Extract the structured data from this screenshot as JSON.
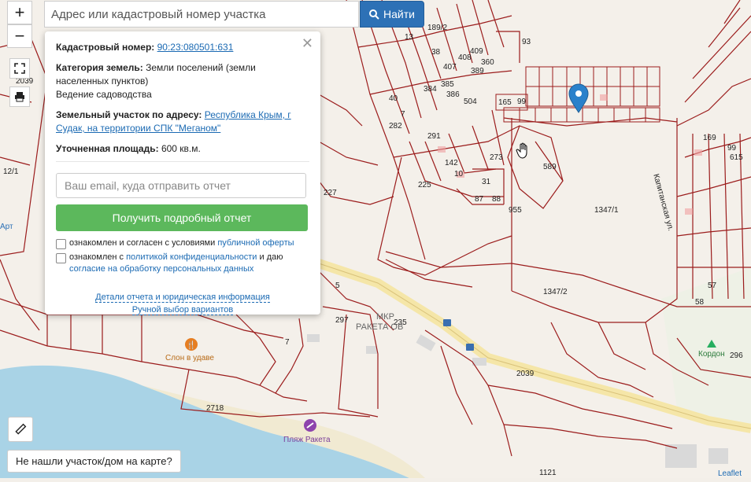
{
  "search": {
    "placeholder": "Адрес или кадастровый номер участка",
    "button_label": "Найти"
  },
  "controls": {
    "zoom_in": "+",
    "zoom_out": "−"
  },
  "popup": {
    "cadastral_label": "Кадастровый номер:",
    "cadastral_value": "90:23:080501:631",
    "category_label": "Категория земель:",
    "category_value": "Земли поселений (земли населенных пунктов)",
    "category_use": "Ведение садоводства",
    "address_label": "Земельный участок по адресу:",
    "address_value": "Республика Крым, г Судак, на территории СПК \"Меганом\"",
    "area_label": "Уточненная площадь:",
    "area_value": "600 кв.м.",
    "email_placeholder": "Ваш email, куда отправить отчет",
    "report_button": "Получить подробный отчет",
    "agree1_text": "ознакомлен и согласен с условиями",
    "agree1_link": "публичной оферты",
    "agree2_text_a": "ознакомлен с",
    "agree2_link_a": "политикой конфиденциальности",
    "agree2_text_b": "и даю",
    "agree2_link_b": "согласие на обработку персональных данных",
    "details_link": "Детали отчета и юридическая информация",
    "manual_link": "Ручной выбор вариантов"
  },
  "bottom_button": "Не нашли участок/дом на карте?",
  "attribution": "Leaflet",
  "map_labels": {
    "l_189_2": "189/2",
    "l_93": "93",
    "l_13": "13",
    "l_38": "38",
    "l_407": "407",
    "l_408": "408",
    "l_409": "409",
    "l_360": "360",
    "l_389": "389",
    "l_385": "385",
    "l_384": "384",
    "l_386": "386",
    "l_504": "504",
    "l_165": "165",
    "l_99": "99",
    "l_40": "40",
    "l_7": "7",
    "l_282": "282",
    "l_291": "291",
    "l_142": "142",
    "l_273": "273",
    "l_10": "10",
    "l_31": "31",
    "l_87": "87",
    "l_88": "88",
    "l_225": "225",
    "l_227": "227",
    "l_955": "955",
    "l_589": "589",
    "l_1347_1": "1347/1",
    "l_1347_2": "1347/2",
    "l_169": "169",
    "l_615": "615",
    "l_99b": "99",
    "l_57": "57",
    "l_58": "58",
    "l_5": "5",
    "l_297": "297",
    "l_235": "235",
    "l_7b": "7",
    "l_2039": "2039",
    "l_2718": "2718",
    "l_1121": "1121",
    "l_296": "296",
    "l_12_1": "12/1",
    "l_2039b": "2039",
    "l_street": "Капитанская ул.",
    "poi_art": "Арт",
    "poi_slon": "Слон в удаве",
    "poi_mkr": "МКР",
    "poi_raketa": "РАКЕТА ОВ",
    "poi_plyazh": "Пляж Ракета",
    "poi_kordon": "Кордон"
  },
  "colors": {
    "parcel_line": "#9b1c1c",
    "sea": "#a9d3e6",
    "road": "#f5e6a8",
    "button_blue": "#2d71b6",
    "button_green": "#5cb85c",
    "marker": "#2a81cb"
  }
}
